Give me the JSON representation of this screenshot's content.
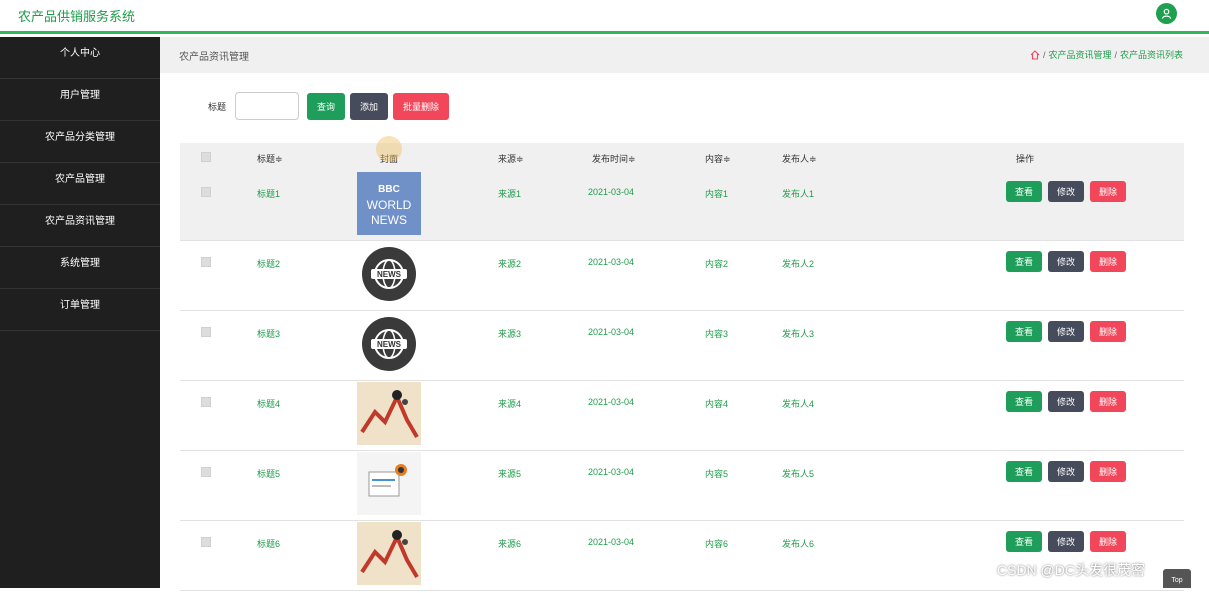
{
  "app": {
    "title": "农产品供销服务系统"
  },
  "sidebar": {
    "items": [
      {
        "label": "个人中心"
      },
      {
        "label": "用户管理"
      },
      {
        "label": "农产品分类管理"
      },
      {
        "label": "农产品管理"
      },
      {
        "label": "农产品资讯管理"
      },
      {
        "label": "系统管理"
      },
      {
        "label": "订单管理"
      }
    ]
  },
  "header": {
    "page_title": "农产品资讯管理",
    "breadcrumb": [
      "农产品资讯管理",
      "农产品资讯列表"
    ]
  },
  "search": {
    "label": "标题",
    "value": "",
    "query_button": "查询",
    "add_button": "添加",
    "batch_delete_button": "批量删除"
  },
  "table": {
    "columns": [
      "标题",
      "封面",
      "来源",
      "发布时间",
      "内容",
      "发布人",
      "操作"
    ],
    "rows": [
      {
        "title": "标题1",
        "source": "来源1",
        "time": "2021-03-04",
        "content": "内容1",
        "author": "发布人1",
        "cover": "bbc"
      },
      {
        "title": "标题2",
        "source": "来源2",
        "time": "2021-03-04",
        "content": "内容2",
        "author": "发布人2",
        "cover": "globe"
      },
      {
        "title": "标题3",
        "source": "来源3",
        "time": "2021-03-04",
        "content": "内容3",
        "author": "发布人3",
        "cover": "globe"
      },
      {
        "title": "标题4",
        "source": "来源4",
        "time": "2021-03-04",
        "content": "内容4",
        "author": "发布人4",
        "cover": "chart"
      },
      {
        "title": "标题5",
        "source": "来源5",
        "time": "2021-03-04",
        "content": "内容5",
        "author": "发布人5",
        "cover": "paper"
      },
      {
        "title": "标题6",
        "source": "来源6",
        "time": "2021-03-04",
        "content": "内容6",
        "author": "发布人6",
        "cover": "chart"
      }
    ],
    "actions": {
      "view": "查看",
      "edit": "修改",
      "delete": "删除"
    },
    "sort_mark": "≑"
  },
  "cover_text": {
    "bbc": "BBC",
    "world": "WORLD",
    "news": "NEWS",
    "globe_news": "NEWS"
  },
  "watermark": "CSDN @DC头发很茂密",
  "top_button": "Top",
  "colors": {
    "accent": "#1f9c4a",
    "danger": "#f2475a",
    "dark": "#474c5c",
    "sidebar": "#1f1f1f"
  }
}
